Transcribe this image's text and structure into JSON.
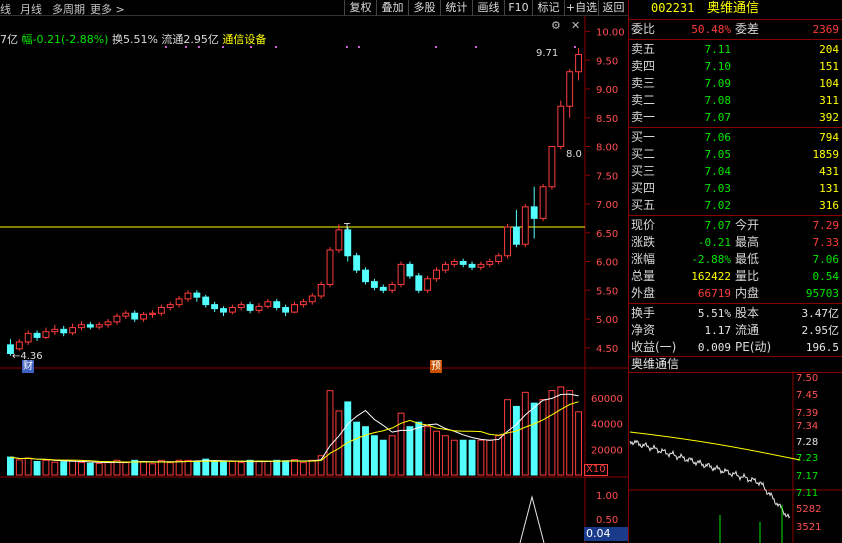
{
  "toolbar": {
    "tabs": [
      "线",
      "月线",
      "多周期",
      "更多 >"
    ],
    "buttons": [
      "复权",
      "叠加",
      "多股",
      "统计",
      "画线",
      "F10",
      "标记",
      "+自选",
      "返回"
    ]
  },
  "info_line": {
    "prefix": "7亿",
    "change": "幅-0.21(-2.88%)",
    "turnover": "换5.51%",
    "float_cap": "流通2.95亿",
    "sector": "通信设备"
  },
  "colors": {
    "up": "#ff3c3c",
    "down": "#54ffff",
    "ma": "#ffff00",
    "bg": "#000000",
    "border": "#8b0000"
  },
  "icons": {
    "settings": "gear-icon",
    "close": "close-icon"
  },
  "labels": {
    "low_marker": "←4.36",
    "high_marker": "9.71",
    "tag_cai": "财",
    "tag_yu": "预",
    "tag_8_0": "8.0",
    "tag_t": "T",
    "x10": "X10",
    "ind_value": "0.04"
  },
  "chart_data": [
    {
      "type": "candlestick",
      "ylim": [
        4.2,
        10.2
      ],
      "y_ticks": [
        "10.00",
        "9.50",
        "9.00",
        "8.50",
        "8.00",
        "7.50",
        "7.00",
        "6.50",
        "6.00",
        "5.50",
        "5.00",
        "4.50"
      ],
      "reference_line": 6.6,
      "candles": [
        [
          4.55,
          4.4,
          4.65,
          4.36
        ],
        [
          4.48,
          4.6,
          4.65,
          4.45
        ],
        [
          4.6,
          4.75,
          4.8,
          4.55
        ],
        [
          4.75,
          4.68,
          4.8,
          4.62
        ],
        [
          4.68,
          4.78,
          4.85,
          4.65
        ],
        [
          4.78,
          4.82,
          4.9,
          4.72
        ],
        [
          4.82,
          4.76,
          4.88,
          4.7
        ],
        [
          4.76,
          4.85,
          4.92,
          4.72
        ],
        [
          4.85,
          4.9,
          4.96,
          4.8
        ],
        [
          4.9,
          4.86,
          4.95,
          4.82
        ],
        [
          4.86,
          4.9,
          4.95,
          4.82
        ],
        [
          4.9,
          4.95,
          5.0,
          4.85
        ],
        [
          4.95,
          5.05,
          5.1,
          4.9
        ],
        [
          5.05,
          5.1,
          5.15,
          5.0
        ],
        [
          5.1,
          5.0,
          5.15,
          4.95
        ],
        [
          5.0,
          5.08,
          5.12,
          4.95
        ],
        [
          5.08,
          5.1,
          5.15,
          5.02
        ],
        [
          5.1,
          5.2,
          5.25,
          5.05
        ],
        [
          5.2,
          5.25,
          5.3,
          5.15
        ],
        [
          5.25,
          5.35,
          5.4,
          5.2
        ],
        [
          5.35,
          5.45,
          5.5,
          5.3
        ],
        [
          5.45,
          5.38,
          5.5,
          5.3
        ],
        [
          5.38,
          5.25,
          5.42,
          5.2
        ],
        [
          5.25,
          5.18,
          5.3,
          5.12
        ],
        [
          5.18,
          5.12,
          5.22,
          5.05
        ],
        [
          5.12,
          5.2,
          5.25,
          5.08
        ],
        [
          5.2,
          5.25,
          5.3,
          5.15
        ],
        [
          5.25,
          5.15,
          5.3,
          5.1
        ],
        [
          5.15,
          5.22,
          5.28,
          5.1
        ],
        [
          5.22,
          5.3,
          5.35,
          5.18
        ],
        [
          5.3,
          5.2,
          5.35,
          5.15
        ],
        [
          5.2,
          5.12,
          5.25,
          5.05
        ],
        [
          5.12,
          5.25,
          5.3,
          5.1
        ],
        [
          5.25,
          5.3,
          5.35,
          5.2
        ],
        [
          5.3,
          5.4,
          5.45,
          5.25
        ],
        [
          5.4,
          5.6,
          5.65,
          5.35
        ],
        [
          5.6,
          6.2,
          6.25,
          5.55
        ],
        [
          6.2,
          6.55,
          6.65,
          6.15
        ],
        [
          6.55,
          6.1,
          6.6,
          6.0
        ],
        [
          6.1,
          5.85,
          6.15,
          5.8
        ],
        [
          5.85,
          5.65,
          5.9,
          5.6
        ],
        [
          5.65,
          5.55,
          5.7,
          5.5
        ],
        [
          5.55,
          5.5,
          5.6,
          5.45
        ],
        [
          5.5,
          5.6,
          5.65,
          5.45
        ],
        [
          5.6,
          5.95,
          6.0,
          5.55
        ],
        [
          5.95,
          5.75,
          6.0,
          5.7
        ],
        [
          5.75,
          5.5,
          5.8,
          5.45
        ],
        [
          5.5,
          5.7,
          5.75,
          5.45
        ],
        [
          5.7,
          5.85,
          5.9,
          5.65
        ],
        [
          5.85,
          5.95,
          6.0,
          5.8
        ],
        [
          5.95,
          6.0,
          6.05,
          5.9
        ],
        [
          6.0,
          5.95,
          6.05,
          5.9
        ],
        [
          5.95,
          5.9,
          6.0,
          5.85
        ],
        [
          5.9,
          5.95,
          6.0,
          5.85
        ],
        [
          5.95,
          6.0,
          6.05,
          5.9
        ],
        [
          6.0,
          6.1,
          6.15,
          5.95
        ],
        [
          6.1,
          6.6,
          6.65,
          6.05
        ],
        [
          6.6,
          6.3,
          6.9,
          6.25
        ],
        [
          6.3,
          6.95,
          7.0,
          6.25
        ],
        [
          6.95,
          6.75,
          7.3,
          6.4
        ],
        [
          6.75,
          7.3,
          7.35,
          6.7
        ],
        [
          7.3,
          8.0,
          8.0,
          7.25
        ],
        [
          8.0,
          8.7,
          8.8,
          7.95
        ],
        [
          8.7,
          9.3,
          9.35,
          8.5
        ],
        [
          9.3,
          9.6,
          9.71,
          9.15
        ]
      ]
    },
    {
      "type": "bar",
      "title": "volume",
      "ylim": [
        0,
        80000
      ],
      "y_ticks": [
        "60000",
        "40000",
        "20000"
      ]
    }
  ],
  "quote": {
    "code": "002231",
    "name": "奥维通信",
    "rows_top": [
      {
        "label": "委比",
        "value": "50.48%",
        "label2": "委差",
        "value2": "2369",
        "c1": "red",
        "c2": "red"
      }
    ],
    "sell": [
      {
        "label": "卖五",
        "price": "7.11",
        "vol": "204"
      },
      {
        "label": "卖四",
        "price": "7.10",
        "vol": "151"
      },
      {
        "label": "卖三",
        "price": "7.09",
        "vol": "104"
      },
      {
        "label": "卖二",
        "price": "7.08",
        "vol": "311"
      },
      {
        "label": "卖一",
        "price": "7.07",
        "vol": "392"
      }
    ],
    "buy": [
      {
        "label": "买一",
        "price": "7.06",
        "vol": "794"
      },
      {
        "label": "买二",
        "price": "7.05",
        "vol": "1859"
      },
      {
        "label": "买三",
        "price": "7.04",
        "vol": "431"
      },
      {
        "label": "买四",
        "price": "7.03",
        "vol": "131"
      },
      {
        "label": "买五",
        "price": "7.02",
        "vol": "316"
      }
    ],
    "stats": [
      {
        "l1": "现价",
        "v1": "7.07",
        "c1": "green",
        "l2": "今开",
        "v2": "7.29",
        "c2": "red"
      },
      {
        "l1": "涨跌",
        "v1": "-0.21",
        "c1": "green",
        "l2": "最高",
        "v2": "7.33",
        "c2": "red"
      },
      {
        "l1": "涨幅",
        "v1": "-2.88%",
        "c1": "green",
        "l2": "最低",
        "v2": "7.06",
        "c2": "green"
      },
      {
        "l1": "总量",
        "v1": "162422",
        "c1": "yellow",
        "l2": "量比",
        "v2": "0.54",
        "c2": "green"
      },
      {
        "l1": "外盘",
        "v1": "66719",
        "c1": "red",
        "l2": "内盘",
        "v2": "95703",
        "c2": "green"
      }
    ],
    "stats2": [
      {
        "l1": "换手",
        "v1": "5.51%",
        "c1": "white",
        "l2": "股本",
        "v2": "3.47亿",
        "c2": "white"
      },
      {
        "l1": "净资",
        "v1": "1.17",
        "c1": "white",
        "l2": "流通",
        "v2": "2.95亿",
        "c2": "white"
      },
      {
        "l1": "收益(一)",
        "v1": "0.009",
        "c1": "white",
        "l2": "PE(动)",
        "v2": "196.5",
        "c2": "white"
      }
    ],
    "intraday_title": "奥维通信",
    "intraday_ticks": [
      "7.50",
      "7.45",
      "7.39",
      "7.34",
      "7.28",
      "7.23",
      "7.17",
      "7.11",
      "5282",
      "3521"
    ]
  }
}
